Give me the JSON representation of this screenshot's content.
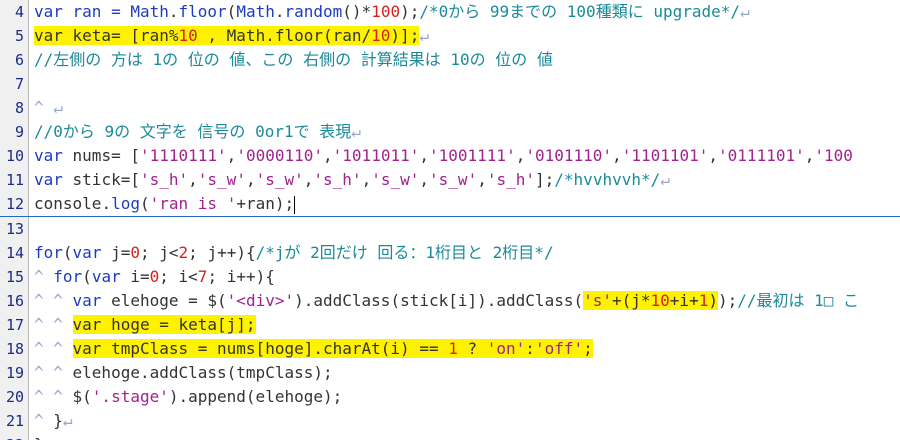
{
  "editor": {
    "tab_glyph": "^",
    "eol_glyph": "↵",
    "lines": [
      {
        "no": "4",
        "indent": 0,
        "eol": true,
        "tokens": [
          {
            "t": "var ran = ",
            "c": "kw"
          },
          {
            "t": "Math",
            "c": "fn"
          },
          {
            "t": ".",
            "c": "txt"
          },
          {
            "t": "floor",
            "c": "fn"
          },
          {
            "t": "(",
            "c": "txt"
          },
          {
            "t": "Math",
            "c": "fn"
          },
          {
            "t": ".",
            "c": "txt"
          },
          {
            "t": "random",
            "c": "fn"
          },
          {
            "t": "()*",
            "c": "txt"
          },
          {
            "t": "100",
            "c": "num"
          },
          {
            "t": ");",
            "c": "txt"
          },
          {
            "t": "/*0から 99までの 100種類に upgrade*/",
            "c": "cmt"
          }
        ]
      },
      {
        "no": "5",
        "indent": 0,
        "eol": true,
        "tokens": [
          {
            "t": "var keta= [ran%",
            "c": "txt",
            "h": true
          },
          {
            "t": "10",
            "c": "num",
            "h": true
          },
          {
            "t": " , Math.floor(ran/",
            "c": "txt",
            "h": true
          },
          {
            "t": "10",
            "c": "num",
            "h": true
          },
          {
            "t": ")];",
            "c": "txt",
            "h": true
          }
        ]
      },
      {
        "no": "6",
        "indent": 0,
        "eol": false,
        "tokens": [
          {
            "t": "//左側の 方は 1の 位の 値、この 右側の 計算結果は 10の 位の 値",
            "c": "cmt"
          }
        ]
      },
      {
        "no": "7",
        "indent": 0,
        "eol": false,
        "tokens": []
      },
      {
        "no": "8",
        "indent": 1,
        "eol": true,
        "tokens": []
      },
      {
        "no": "9",
        "indent": 0,
        "eol": true,
        "tokens": [
          {
            "t": "//0から 9の 文字を 信号の 0or1で 表現",
            "c": "cmt"
          }
        ]
      },
      {
        "no": "10",
        "indent": 0,
        "eol": false,
        "tokens": [
          {
            "t": "var",
            "c": "kw"
          },
          {
            "t": " nums= [",
            "c": "txt"
          },
          {
            "t": "'1110111'",
            "c": "str"
          },
          {
            "t": ",",
            "c": "txt"
          },
          {
            "t": "'0000110'",
            "c": "str"
          },
          {
            "t": ",",
            "c": "txt"
          },
          {
            "t": "'1011011'",
            "c": "str"
          },
          {
            "t": ",",
            "c": "txt"
          },
          {
            "t": "'1001111'",
            "c": "str"
          },
          {
            "t": ",",
            "c": "txt"
          },
          {
            "t": "'0101110'",
            "c": "str"
          },
          {
            "t": ",",
            "c": "txt"
          },
          {
            "t": "'1101101'",
            "c": "str"
          },
          {
            "t": ",",
            "c": "txt"
          },
          {
            "t": "'0111101'",
            "c": "str"
          },
          {
            "t": ",",
            "c": "txt"
          },
          {
            "t": "'100",
            "c": "str"
          }
        ]
      },
      {
        "no": "11",
        "indent": 0,
        "eol": true,
        "tokens": [
          {
            "t": "var",
            "c": "kw"
          },
          {
            "t": " stick=[",
            "c": "txt"
          },
          {
            "t": "'s_h'",
            "c": "str"
          },
          {
            "t": ",",
            "c": "txt"
          },
          {
            "t": "'s_w'",
            "c": "str"
          },
          {
            "t": ",",
            "c": "txt"
          },
          {
            "t": "'s_w'",
            "c": "str"
          },
          {
            "t": ",",
            "c": "txt"
          },
          {
            "t": "'s_h'",
            "c": "str"
          },
          {
            "t": ",",
            "c": "txt"
          },
          {
            "t": "'s_w'",
            "c": "str"
          },
          {
            "t": ",",
            "c": "txt"
          },
          {
            "t": "'s_w'",
            "c": "str"
          },
          {
            "t": ",",
            "c": "txt"
          },
          {
            "t": "'s_h'",
            "c": "str"
          },
          {
            "t": "];",
            "c": "txt"
          },
          {
            "t": "/*hvvhvvh*/",
            "c": "cmt"
          }
        ]
      },
      {
        "no": "12",
        "indent": 0,
        "eol": false,
        "cursor": true,
        "tokens": [
          {
            "t": "console",
            "c": "txt"
          },
          {
            "t": ".",
            "c": "txt"
          },
          {
            "t": "log",
            "c": "fn"
          },
          {
            "t": "(",
            "c": "txt"
          },
          {
            "t": "'ran is '",
            "c": "str"
          },
          {
            "t": "+ran);",
            "c": "txt"
          }
        ]
      },
      {
        "no": "13",
        "indent": 0,
        "eol": false,
        "tokens": []
      },
      {
        "no": "14",
        "indent": 0,
        "eol": false,
        "tokens": [
          {
            "t": "for",
            "c": "kw"
          },
          {
            "t": "(",
            "c": "txt"
          },
          {
            "t": "var",
            "c": "kw"
          },
          {
            "t": " j=",
            "c": "txt"
          },
          {
            "t": "0",
            "c": "num"
          },
          {
            "t": "; j<",
            "c": "txt"
          },
          {
            "t": "2",
            "c": "num"
          },
          {
            "t": "; j++){",
            "c": "txt"
          },
          {
            "t": "/*jが 2回だけ 回る：1桁目と 2桁目*/",
            "c": "cmt"
          }
        ]
      },
      {
        "no": "15",
        "indent": 1,
        "eol": false,
        "tokens": [
          {
            "t": "for",
            "c": "kw"
          },
          {
            "t": "(",
            "c": "txt"
          },
          {
            "t": "var",
            "c": "kw"
          },
          {
            "t": " i=",
            "c": "txt"
          },
          {
            "t": "0",
            "c": "num"
          },
          {
            "t": "; i<",
            "c": "txt"
          },
          {
            "t": "7",
            "c": "num"
          },
          {
            "t": "; i++){",
            "c": "txt"
          }
        ]
      },
      {
        "no": "16",
        "indent": 2,
        "eol": false,
        "tokens": [
          {
            "t": "var",
            "c": "kw"
          },
          {
            "t": " elehoge = $(",
            "c": "txt"
          },
          {
            "t": "'<div>'",
            "c": "str"
          },
          {
            "t": ").addClass(stick[i]).addClass(",
            "c": "txt"
          },
          {
            "t": "'s'",
            "c": "str",
            "h": true
          },
          {
            "t": "+(j*",
            "c": "txt",
            "h": true
          },
          {
            "t": "10",
            "c": "num",
            "h": true
          },
          {
            "t": "+i+",
            "c": "txt",
            "h": true
          },
          {
            "t": "1",
            "c": "num",
            "h": true
          },
          {
            "t": ")",
            "c": "txt",
            "h": true
          },
          {
            "t": ");",
            "c": "txt"
          },
          {
            "t": "//最初は 1□ こ",
            "c": "cmt"
          }
        ]
      },
      {
        "no": "17",
        "indent": 2,
        "eol": false,
        "tokens": [
          {
            "t": "var hoge = keta[j];",
            "c": "txt",
            "h": true
          }
        ]
      },
      {
        "no": "18",
        "indent": 2,
        "eol": false,
        "tokens": [
          {
            "t": "var tmpClass = nums[hoge].charAt(i) == ",
            "c": "txt",
            "h": true
          },
          {
            "t": "1",
            "c": "num",
            "h": true
          },
          {
            "t": " ? ",
            "c": "txt",
            "h": true
          },
          {
            "t": "'on'",
            "c": "str",
            "h": true
          },
          {
            "t": ":",
            "c": "txt",
            "h": true
          },
          {
            "t": "'off'",
            "c": "str",
            "h": true
          },
          {
            "t": ";",
            "c": "txt",
            "h": true
          }
        ]
      },
      {
        "no": "19",
        "indent": 2,
        "eol": false,
        "tokens": [
          {
            "t": "elehoge.addClass(tmpClass);",
            "c": "txt"
          }
        ]
      },
      {
        "no": "20",
        "indent": 2,
        "eol": false,
        "tokens": [
          {
            "t": "$(",
            "c": "txt"
          },
          {
            "t": "'.stage'",
            "c": "str"
          },
          {
            "t": ").append(elehoge);",
            "c": "txt"
          }
        ]
      },
      {
        "no": "21",
        "indent": 1,
        "eol": true,
        "tokens": [
          {
            "t": "}",
            "c": "txt"
          }
        ]
      },
      {
        "no": "22",
        "indent": 0,
        "eol": false,
        "tokens": [
          {
            "t": "}",
            "c": "txt"
          }
        ]
      }
    ]
  }
}
